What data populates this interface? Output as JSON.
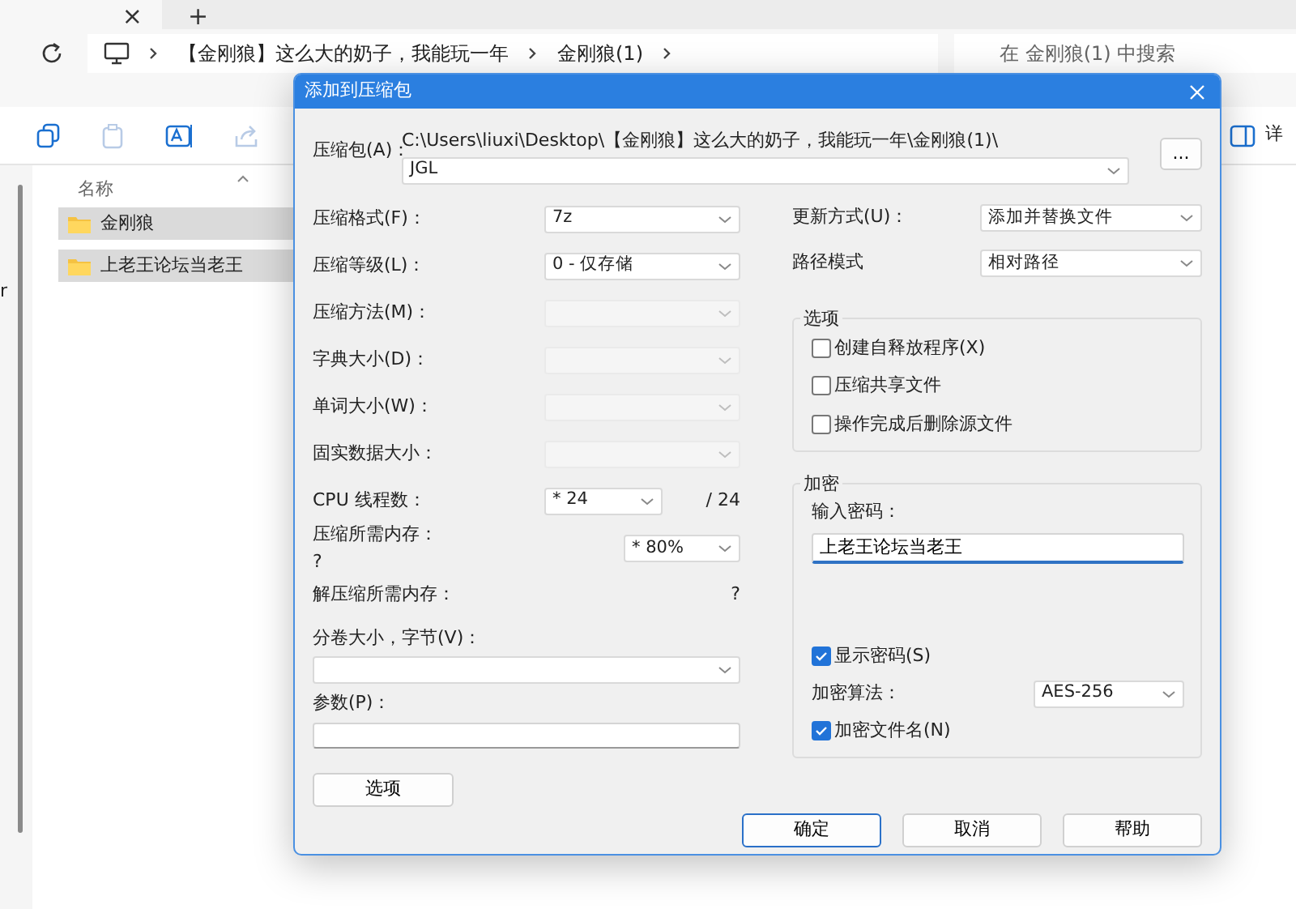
{
  "tab_strip": {
    "close_glyph": "×",
    "new_tab_glyph": "+"
  },
  "address_bar": {
    "segments": [
      "【金刚狼】这么大的奶子，我能玩一年",
      "金刚狼(1)"
    ]
  },
  "search": {
    "placeholder": "在 金刚狼(1) 中搜索"
  },
  "toolbar": {
    "details_label": "详"
  },
  "nav_pane": {
    "partial_text": "r"
  },
  "file_list": {
    "column": "名称",
    "rows": [
      {
        "name": "金刚狼",
        "selected": true
      },
      {
        "name": "上老王论坛当老王",
        "selected": true
      }
    ]
  },
  "dialog": {
    "title": "添加到压缩包",
    "archive": {
      "label": "压缩包(A)：",
      "path": "C:\\Users\\liuxi\\Desktop\\【金刚狼】这么大的奶子，我能玩一年\\金刚狼(1)\\",
      "value": "JGL",
      "browse": "..."
    },
    "left_fields": [
      {
        "kind": "select",
        "label": "压缩格式(F)：",
        "value": "7z",
        "disabled": false
      },
      {
        "kind": "select",
        "label": "压缩等级(L)：",
        "value": "0 - 仅存储",
        "disabled": false
      },
      {
        "kind": "select",
        "label": "压缩方法(M)：",
        "disabled": true
      },
      {
        "kind": "select",
        "label": "字典大小(D)：",
        "disabled": true
      },
      {
        "kind": "select",
        "label": "单词大小(W)：",
        "disabled": true
      },
      {
        "kind": "select",
        "label": "固实数据大小：",
        "disabled": true
      },
      {
        "kind": "threads",
        "label": "CPU 线程数：",
        "value": "* 24",
        "suffix": "/ 24"
      },
      {
        "kind": "memory",
        "label": "压缩所需内存：",
        "note": "?",
        "value": "* 80%"
      },
      {
        "kind": "info",
        "label": "解压缩所需内存：",
        "note": "?"
      },
      {
        "kind": "combo",
        "label": "分卷大小，字节(V)："
      },
      {
        "kind": "input",
        "label": "参数(P)："
      }
    ],
    "options_button": "选项",
    "right_fields": [
      {
        "label": "更新方式(U)：",
        "value": "添加并替换文件"
      },
      {
        "label": "路径模式",
        "value": "相对路径"
      }
    ],
    "options_group": {
      "title": "选项",
      "checkboxes": [
        {
          "label": "创建自释放程序(X)",
          "checked": false
        },
        {
          "label": "压缩共享文件",
          "checked": false
        },
        {
          "label": "操作完成后删除源文件",
          "checked": false
        }
      ]
    },
    "encryption": {
      "title": "加密",
      "password_label": "输入密码：",
      "password": "上老王论坛当老王",
      "show_password": {
        "label": "显示密码(S)",
        "checked": true
      },
      "method_label": "加密算法：",
      "method": "AES-256",
      "encrypt_names": {
        "label": "加密文件名(N)",
        "checked": true
      }
    },
    "buttons": [
      {
        "label": "确定",
        "focused": true
      },
      {
        "label": "取消",
        "focused": false
      },
      {
        "label": "帮助",
        "focused": false
      }
    ]
  }
}
